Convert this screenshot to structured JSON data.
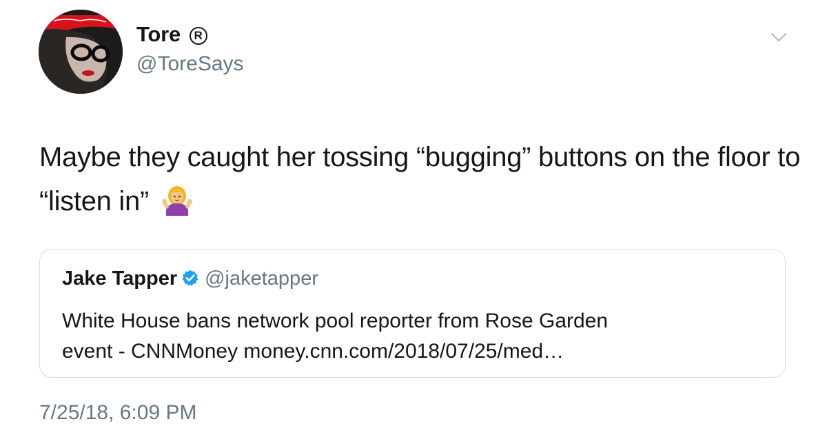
{
  "author": {
    "display_name": "Tore",
    "registered_mark": "R",
    "handle": "@ToreSays",
    "avatar_icon": "profile-photo"
  },
  "menu": {
    "icon": "chevron-down-icon"
  },
  "tweet": {
    "text": "Maybe they caught her tossing “bugging” buttons on the floor to “listen in”",
    "emoji_icon": "woman-shrugging-emoji"
  },
  "quoted_tweet": {
    "display_name": "Jake Tapper",
    "verified_icon": "verified-badge-icon",
    "handle": "@jaketapper",
    "text_line1": "White House bans network pool reporter from Rose Garden",
    "text_line2": "event  - CNNMoney money.cnn.com/2018/07/25/med…"
  },
  "timestamp": "7/25/18, 6:09 PM",
  "colors": {
    "text_primary": "#14171a",
    "text_secondary": "#657786",
    "border": "#d8dee3",
    "verified_blue": "#1da1f2"
  }
}
